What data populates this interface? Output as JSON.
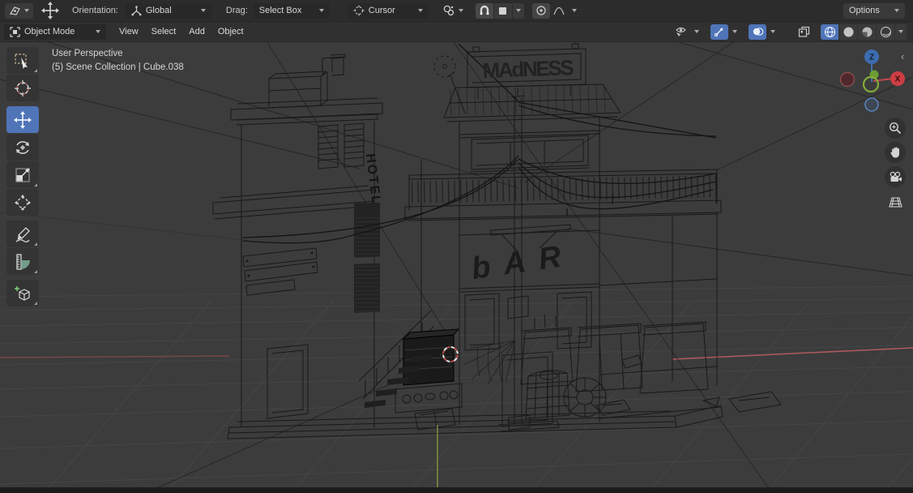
{
  "topbar": {
    "orientation_label": "Orientation:",
    "orientation_value": "Global",
    "drag_label": "Drag:",
    "select_mode_value": "Select Box",
    "cursor_tool_value": "Cursor",
    "options_label": "Options"
  },
  "viewport_header": {
    "mode": "Object Mode",
    "menus": [
      "View",
      "Select",
      "Add",
      "Object"
    ]
  },
  "toolbar_tools": [
    "tweak-select",
    "cursor",
    "move",
    "rotate",
    "scale",
    "transform",
    "annotate",
    "measure",
    "add-cube"
  ],
  "viewport": {
    "view_label": "User Perspective",
    "collection_label": "(5) Scene Collection | Cube.038",
    "signs": {
      "top": "MAdNESS",
      "hotel": "HOTEL",
      "bar": "bAR"
    },
    "gizmo": {
      "z_label": "Z",
      "x_label": "X"
    }
  },
  "colors": {
    "accent_blue": "#4f74b8",
    "axis_x_red": "#b15a5e",
    "axis_y_green": "#7d9140",
    "gizmo_z_blue": "#3d6cb0",
    "gizmo_x_red": "#cc3d44",
    "background": "#3c3c3c"
  }
}
